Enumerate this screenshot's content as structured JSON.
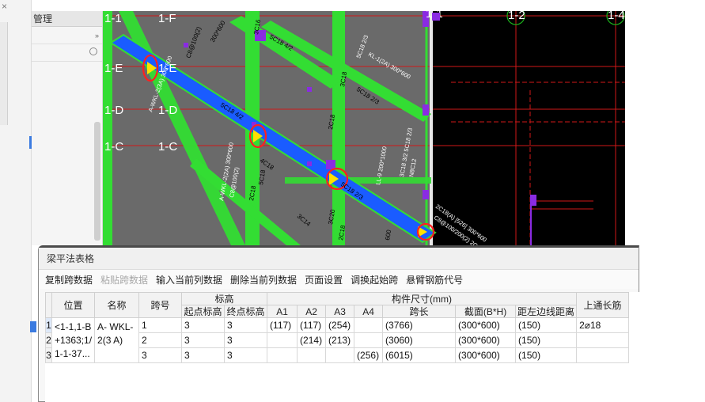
{
  "window": {
    "close_glyph": "×"
  },
  "attr_panel": {
    "title": "管理",
    "expand_glyph": "»",
    "search_icon": "search-icon"
  },
  "cad": {
    "grid_labels": {
      "top": [
        "1-1",
        "1-F",
        "1-1",
        "1-2",
        "1-4"
      ],
      "left": [
        "1-E",
        "1-D",
        "1-C"
      ],
      "mid": [
        "1-E",
        "1-D",
        "1-C"
      ]
    },
    "beam_annotations": [
      "5C18 4/2",
      "3C16",
      "300*600",
      "C8@100(2)",
      "5C18 2/3",
      "3C18",
      "5C18 2/3",
      "N4C12",
      "4C18",
      "5C18 2/3",
      "3C20",
      "2C18",
      "4C18 2/2/4",
      "C8@100(2)",
      "3C18",
      "5C20",
      "LL-9 200*1000",
      "3C18 3/2",
      "N8C12",
      "2C18",
      "2C18;5C20;2C18",
      "3C18",
      "5C18",
      "N4C12",
      "3C20",
      "3C18",
      "A-WKL-2(2A) 300*600",
      "3C18;3C18",
      "C8@100(2)",
      "2C18;3C18",
      "WKL-2(3A) 300*600",
      "600",
      "2C18(3C18)"
    ],
    "colors": {
      "background": "#000000",
      "beam_green": "#33dd33",
      "beam_blue": "#1a5cff",
      "hatch_grey": "#6e6e6e",
      "grid_red": "#d01818",
      "highlight_circle": "#ff2020",
      "marker_purple": "#8a2be2",
      "marker_yellow": "#ffe000",
      "text_white": "#ffffff"
    }
  },
  "dialog": {
    "title": "梁平法表格",
    "toolbar": [
      {
        "label": "复制跨数据",
        "enabled": true
      },
      {
        "label": "粘贴跨数据",
        "enabled": false
      },
      {
        "label": "输入当前列数据",
        "enabled": true
      },
      {
        "label": "删除当前列数据",
        "enabled": true
      },
      {
        "label": "页面设置",
        "enabled": true
      },
      {
        "label": "调换起始跨",
        "enabled": true
      },
      {
        "label": "悬臂钢筋代号",
        "enabled": true
      }
    ],
    "headers": {
      "position": "位置",
      "name": "名称",
      "span": "跨号",
      "elevation_group": "标高",
      "start_elev": "起点标高",
      "end_elev": "终点标高",
      "size_group": "构件尺寸(mm)",
      "a1": "A1",
      "a2": "A2",
      "a3": "A3",
      "a4": "A4",
      "span_len": "跨长",
      "section": "截面(B*H)",
      "edge_dist": "距左边线距离",
      "top_rebar": "上通长筋"
    },
    "position_text": "<1-1,1-B +1363;1/ 1-1-37...",
    "name_text": "A- WKL-2(3 A)",
    "rows": [
      {
        "num": "1",
        "span": "1",
        "start": "3",
        "end": "3",
        "a1": "(117)",
        "a2": "(117)",
        "a3": "(254)",
        "a4": "",
        "len": "(3766)",
        "section": "(300*600)",
        "edge": "(150)",
        "top": "2⌀18"
      },
      {
        "num": "2",
        "span": "2",
        "start": "3",
        "end": "3",
        "a1": "",
        "a2": "(214)",
        "a3": "(213)",
        "a4": "",
        "len": "(3060)",
        "section": "(300*600)",
        "edge": "(150)",
        "top": ""
      },
      {
        "num": "3",
        "span": "3",
        "start": "3",
        "end": "3",
        "a1": "",
        "a2": "",
        "a3": "",
        "a4": "(256)",
        "len": "(6015)",
        "section": "(300*600)",
        "edge": "(150)",
        "top": ""
      }
    ]
  }
}
